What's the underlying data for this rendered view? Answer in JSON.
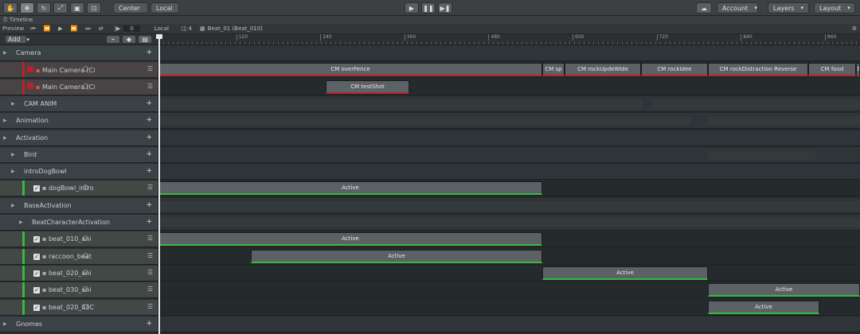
{
  "toolbar": {
    "pivot": "Center",
    "space": "Local",
    "account": "Account",
    "layers": "Layers",
    "layout": "Layout"
  },
  "window": {
    "title": "Timeline"
  },
  "timeline_bar": {
    "preview": "Preview",
    "frame": "0",
    "local": "Local",
    "layer_count": "4",
    "sequence": "Beat_01 (Beat_010)"
  },
  "add_button": "Add",
  "ruler_ticks": [
    "120",
    "240",
    "360",
    "480",
    "600",
    "720",
    "840",
    "960"
  ],
  "tracks": [
    {
      "label": "Camera",
      "kind": "group",
      "indent": 20
    },
    {
      "label": "Main Camera (Ci",
      "kind": "red",
      "indent": 34
    },
    {
      "label": "Main Camera (Ci",
      "kind": "red",
      "indent": 34
    },
    {
      "label": "CAM ANIM",
      "kind": "group",
      "indent": 30
    },
    {
      "label": "Animation",
      "kind": "group",
      "indent": 20
    },
    {
      "label": "Activation",
      "kind": "group",
      "indent": 20
    },
    {
      "label": "Bird",
      "kind": "group",
      "indent": 30
    },
    {
      "label": "introDogBowl",
      "kind": "group",
      "indent": 30
    },
    {
      "label": "dogBowl_intro",
      "kind": "green",
      "indent": 42
    },
    {
      "label": "BaseActivation",
      "kind": "group",
      "indent": 30
    },
    {
      "label": "BeatCharacterActivations",
      "kind": "group",
      "indent": 40
    },
    {
      "label": "beat_010_ani",
      "kind": "green",
      "indent": 42
    },
    {
      "label": "raccoon_beat",
      "kind": "green",
      "indent": 42
    },
    {
      "label": "beat_020_ani",
      "kind": "green",
      "indent": 42
    },
    {
      "label": "beat_030_ani",
      "kind": "green",
      "indent": 42
    },
    {
      "label": "beat_020_03C",
      "kind": "green",
      "indent": 42
    },
    {
      "label": "Gnomes",
      "kind": "group",
      "indent": 20
    }
  ],
  "clips": {
    "row1": [
      "CM overFence",
      "CM sp",
      "CM rockUpdeWide",
      "CM rockIdee",
      "CM rockDistraction Reverse",
      "CM food",
      "CM"
    ],
    "row2": [
      "CM testShot"
    ],
    "row8": [
      "Active"
    ],
    "row11": [
      "Active"
    ],
    "row12": [
      "Active"
    ],
    "row13": [
      "Active"
    ],
    "row14": [
      "Active"
    ],
    "row15": [
      "Active"
    ]
  },
  "colors": {
    "camera_clip": "#b4252a",
    "activation_clip": "#36b93e",
    "accent": "#3a7bd5"
  },
  "icons": [
    "hand-icon",
    "move-icon",
    "rotate-icon",
    "scale-icon",
    "rect-icon",
    "transform-icon",
    "play-icon",
    "pause-icon",
    "step-icon",
    "cloud-icon",
    "gear-icon"
  ]
}
